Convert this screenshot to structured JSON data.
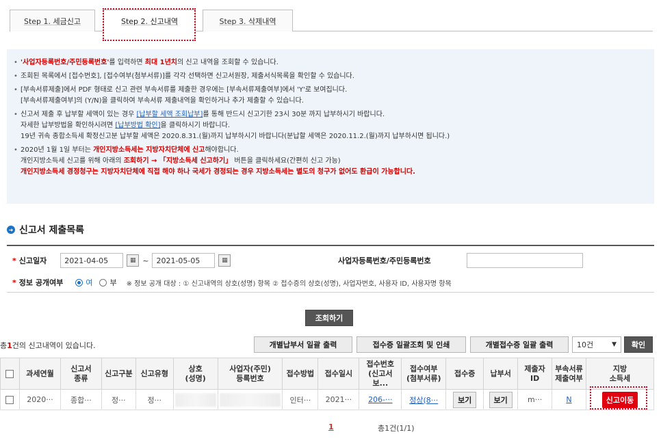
{
  "tabs": [
    {
      "label": "Step 1. 세금신고"
    },
    {
      "label": "Step 2. 신고내역"
    },
    {
      "label": "Step 3. 삭제내역"
    }
  ],
  "notice": {
    "items": [
      {
        "lines": [
          {
            "parts": [
              {
                "t": "'사업자등록번호/주민등록번호'",
                "style": "red"
              },
              {
                "t": "를 입력하면 "
              },
              {
                "t": "최대 1년치",
                "style": "red"
              },
              {
                "t": "의 신고 내역을 조회할 수 있습니다."
              }
            ]
          }
        ]
      },
      {
        "lines": [
          {
            "parts": [
              {
                "t": "조회된 목록에서 [접수번호], [접수여부(첨부서류)]를 각각 선택하면 신고서원장, 제출서식목록을 확인할 수 있습니다."
              }
            ]
          }
        ]
      },
      {
        "lines": [
          {
            "parts": [
              {
                "t": "[부속서류제출]에서 PDF 형태로 신고 관련 부속서류를 제출한 경우에는 [부속서류제출여부]에서 'Y'로 보여집니다."
              }
            ]
          },
          {
            "parts": [
              {
                "t": "[부속서류제출여부]의 (Y/N)을 클릭하여 부속서류 제출내역을 확인하거나 추가 제출할 수 있습니다."
              }
            ]
          }
        ]
      },
      {
        "lines": [
          {
            "parts": [
              {
                "t": "신고서 제출 후 납부할 세액이 있는 경우 "
              },
              {
                "t": "[납부할 세액 조회납부]",
                "style": "link"
              },
              {
                "t": "를 통해 반드시 신고기한 23시 30분 까지 납부하시기 바랍니다."
              }
            ]
          },
          {
            "parts": [
              {
                "t": "자세한 납부방법을 확인하시려면 "
              },
              {
                "t": "[납부방법 확인]",
                "style": "link"
              },
              {
                "t": "을 클릭하시기 바랍니다."
              }
            ]
          },
          {
            "parts": [
              {
                "t": "19년 귀속 종합소득세 확정신고분 납부할 세액은 2020.8.31.(월)까지 납부하시기 바랍니다(분납할 세액은 2020.11.2.(월)까지 납부하시면 됩니다.)"
              }
            ]
          }
        ]
      },
      {
        "lines": [
          {
            "parts": [
              {
                "t": "2020년 1월 1일 부터는 "
              },
              {
                "t": "개인지방소득세는 지방자치단체에 신고",
                "style": "red"
              },
              {
                "t": "해야합니다."
              }
            ]
          },
          {
            "parts": [
              {
                "t": "개인지방소득세 신고를 위해 아래의 "
              },
              {
                "t": "조회하기 → 「지방소득세 신고하기」",
                "style": "red"
              },
              {
                "t": " 버튼을 클릭하세요(간편히 신고 가능)"
              }
            ]
          },
          {
            "parts": [
              {
                "t": "개인지방소득세 경정청구는 지방자치단체에 직접 해야 하나 국세가 경정되는 경우 지방소득세는 별도의 청구가 없어도 환급이 가능합니다.",
                "style": "red"
              }
            ]
          }
        ]
      }
    ]
  },
  "section": {
    "title": "신고서 제출목록"
  },
  "search": {
    "date_label": "신고일자",
    "date_from": "2021-04-05",
    "date_sep": "~",
    "date_to": "2021-05-05",
    "bizno_label": "사업자등록번호/주민등록번호",
    "bizno_value": "",
    "public_label": "정보 공개여부",
    "radio_yes": "여",
    "radio_no": "부",
    "public_note": "※ 정보 공개 대상 : ① 신고내역의 상호(성명) 항목 ② 접수증의 상호(성명), 사업자번호, 사용자 ID, 사용자명 항목",
    "selected": "yes"
  },
  "buttons": {
    "search": "조회하기",
    "bulk_payment": "개별납부서 일괄 출력",
    "bulk_receipt": "접수증 일괄조회 및 인쇄",
    "individual_receipt": "개별접수증 일괄 출력",
    "page_size": "10건",
    "confirm": "확인"
  },
  "result": {
    "prefix": "총",
    "count": "1",
    "suffix": "건의 신고내역이 있습니다."
  },
  "table": {
    "headers": [
      "",
      "과세연월",
      "신고서\n종류",
      "신고구분",
      "신고유형",
      "상호\n(성명)",
      "사업자(주민)\n등록번호",
      "접수방법",
      "접수일시",
      "접수번호\n(신고서보...",
      "접수여부\n(첨부서류)",
      "접수증",
      "납부서",
      "제출자\nID",
      "부속서류\n제출여부",
      "지방\n소득세"
    ],
    "rows": [
      {
        "period": "2020···",
        "type": "종합···",
        "division": "정···",
        "kind": "정···",
        "method": "인터···",
        "datetime": "2021···",
        "receipt_no": "206-···",
        "status": "정상(8···",
        "receipt_btn": "보기",
        "payment_btn": "보기",
        "submitter": "m···",
        "attach": "N",
        "local_tax_btn": "신고이동"
      }
    ]
  },
  "pager": {
    "current": "1",
    "total": "총1건(1/1)"
  }
}
